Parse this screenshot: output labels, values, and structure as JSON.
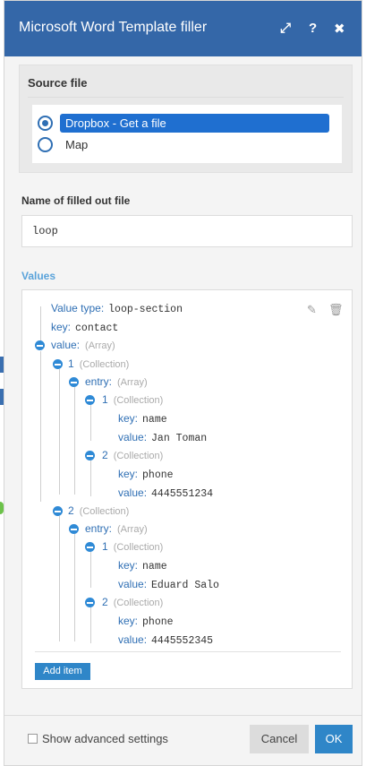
{
  "window": {
    "title": "Microsoft Word Template filler",
    "expand_icon": "⤢",
    "help_icon": "?",
    "close_icon": "✖"
  },
  "source": {
    "label": "Source file",
    "options": [
      {
        "label": "Dropbox - Get a file",
        "selected": true
      },
      {
        "label": "Map",
        "selected": false
      }
    ]
  },
  "filled_name": {
    "label": "Name of filled out file",
    "value": "loop"
  },
  "values": {
    "label": "Values",
    "value_type_key": "Value type:",
    "value_type": "loop-section",
    "key_key": "key:",
    "key_value": "contact",
    "value_key": "value:",
    "value_hint": "(Array)",
    "entries": [
      {
        "index": "1",
        "hint": "(Collection)",
        "entry_key": "entry:",
        "entry_hint": "(Array)",
        "items": [
          {
            "index": "1",
            "hint": "(Collection)",
            "key_label": "key:",
            "key": "name",
            "value_label": "value:",
            "value": "Jan Toman"
          },
          {
            "index": "2",
            "hint": "(Collection)",
            "key_label": "key:",
            "key": "phone",
            "value_label": "value:",
            "value": "4445551234"
          }
        ]
      },
      {
        "index": "2",
        "hint": "(Collection)",
        "entry_key": "entry:",
        "entry_hint": "(Array)",
        "items": [
          {
            "index": "1",
            "hint": "(Collection)",
            "key_label": "key:",
            "key": "name",
            "value_label": "value:",
            "value": "Eduard Salo"
          },
          {
            "index": "2",
            "hint": "(Collection)",
            "key_label": "key:",
            "key": "phone",
            "value_label": "value:",
            "value": "4445552345"
          }
        ]
      }
    ],
    "edit_icon": "✎",
    "delete_icon": "🗑",
    "add_item_label": "Add item"
  },
  "footer": {
    "advanced_label": "Show advanced settings",
    "cancel_label": "Cancel",
    "ok_label": "OK"
  },
  "colors": {
    "titlebar": "#3467a8",
    "accent": "#2f86c8",
    "selected_option": "#1f6fd0"
  }
}
